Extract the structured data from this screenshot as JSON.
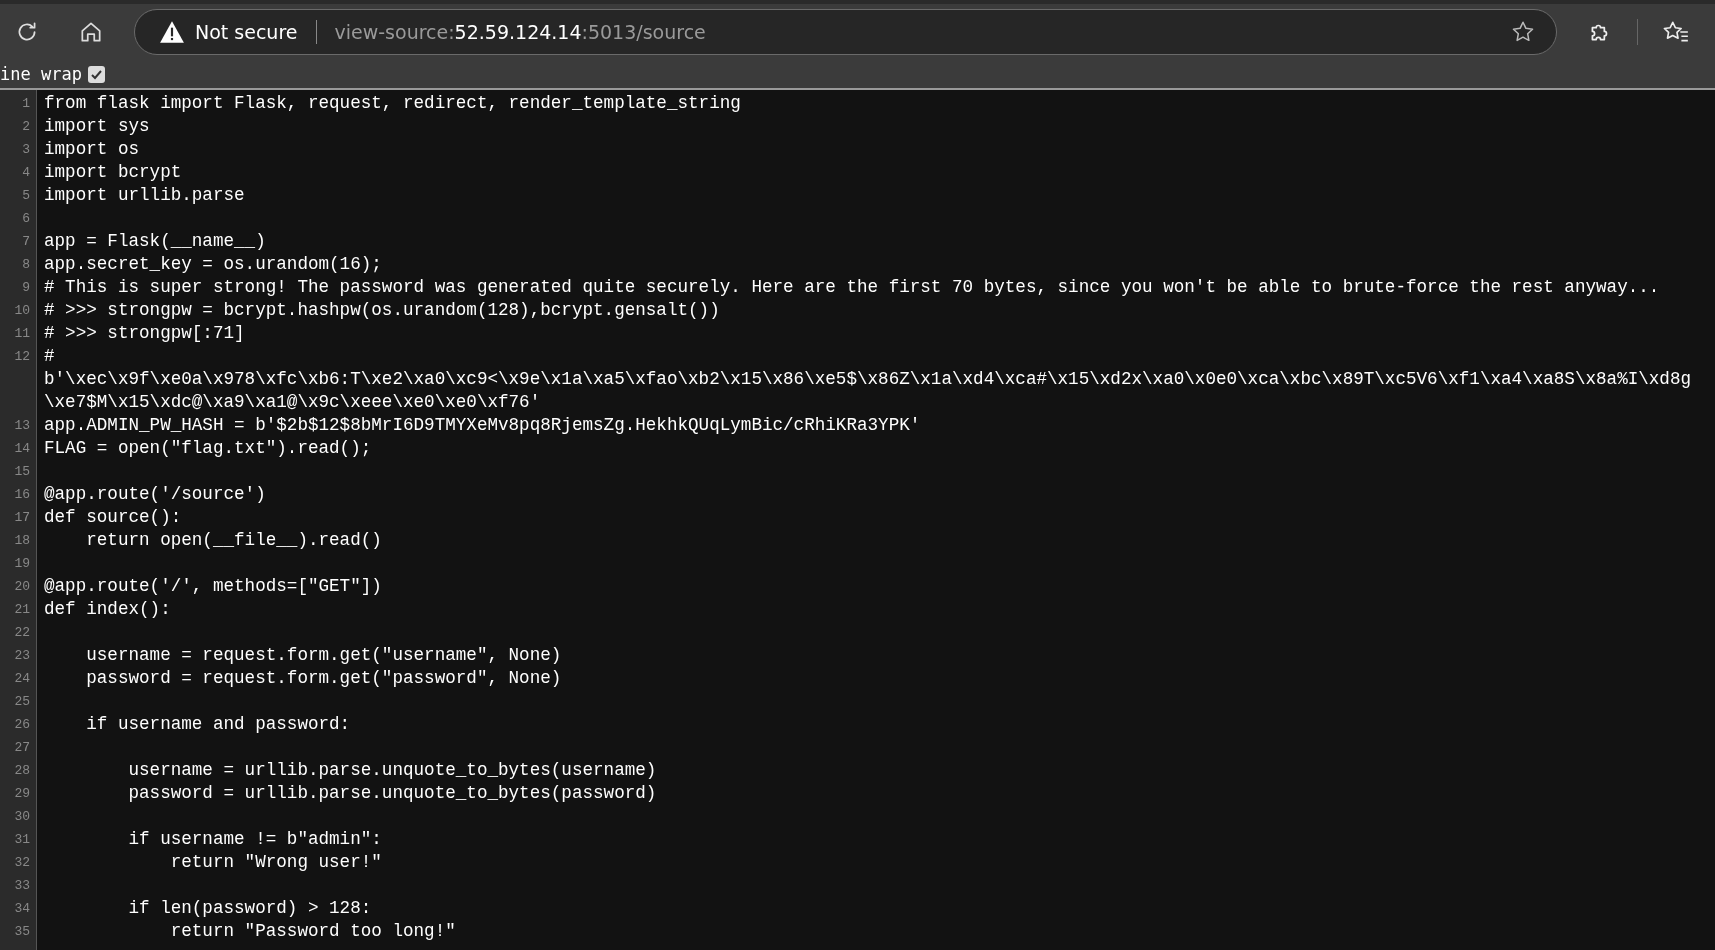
{
  "toolbar": {
    "security": "Not secure",
    "url": [
      {
        "text": "view-source:",
        "kind": "dim"
      },
      {
        "text": "52.59.124.14",
        "kind": "host"
      },
      {
        "text": ":5013/source",
        "kind": "dim"
      }
    ]
  },
  "line_wrap": {
    "label": "ine wrap",
    "checked": true
  },
  "lines": [
    {
      "number": "1",
      "text": "from flask import Flask, request, redirect, render_template_string"
    },
    {
      "number": "2",
      "text": "import sys"
    },
    {
      "number": "3",
      "text": "import os"
    },
    {
      "number": "4",
      "text": "import bcrypt"
    },
    {
      "number": "5",
      "text": "import urllib.parse"
    },
    {
      "number": "6"
    },
    {
      "number": "7",
      "text": "app = Flask(__name__)"
    },
    {
      "number": "8",
      "text": "app.secret_key = os.urandom(16);"
    },
    {
      "number": "9",
      "text": "# This is super strong! The password was generated quite securely. Here are the first 70 bytes, since you won't be able to brute-force the rest anyway..."
    },
    {
      "number": "10",
      "text": "# >>> strongpw = bcrypt.hashpw(os.urandom(128),bcrypt.gensalt())"
    },
    {
      "number": "11",
      "text": "# >>> strongpw[:71]"
    },
    {
      "number": "12",
      "rows": [
        "#",
        "b'\\xec\\x9f\\xe0a\\x978\\xfc\\xb6:T\\xe2\\xa0\\xc9<\\x9e\\x1a\\xa5\\xfao\\xb2\\x15\\x86\\xe5$\\x86Z\\x1a\\xd4\\xca#\\x15\\xd2x\\xa0\\x0e0\\xca\\xbc\\x89T\\xc5V6\\xf1\\xa4\\xa8S\\x8a%I\\xd8g",
        "\\xe7$M\\x15\\xdc@\\xa9\\xa1@\\x9c\\xeee\\xe0\\xe0\\xf76'"
      ]
    },
    {
      "number": "13",
      "text": "app.ADMIN_PW_HASH = b'$2b$12$8bMrI6D9TMYXeMv8pq8RjemsZg.HekhkQUqLymBic/cRhiKRa3YPK'"
    },
    {
      "number": "14",
      "text": "FLAG = open(\"flag.txt\").read();"
    },
    {
      "number": "15"
    },
    {
      "number": "16",
      "text": "@app.route('/source')"
    },
    {
      "number": "17",
      "text": "def source():"
    },
    {
      "number": "18",
      "text": "    return open(__file__).read()"
    },
    {
      "number": "19"
    },
    {
      "number": "20",
      "text": "@app.route('/', methods=[\"GET\"])"
    },
    {
      "number": "21",
      "text": "def index():"
    },
    {
      "number": "22"
    },
    {
      "number": "23",
      "text": "    username = request.form.get(\"username\", None)"
    },
    {
      "number": "24",
      "text": "    password = request.form.get(\"password\", None)"
    },
    {
      "number": "25"
    },
    {
      "number": "26",
      "text": "    if username and password:"
    },
    {
      "number": "27"
    },
    {
      "number": "28",
      "text": "        username = urllib.parse.unquote_to_bytes(username)"
    },
    {
      "number": "29",
      "text": "        password = urllib.parse.unquote_to_bytes(password)"
    },
    {
      "number": "30"
    },
    {
      "number": "31",
      "text": "        if username != b\"admin\":"
    },
    {
      "number": "32",
      "text": "            return \"Wrong user!\""
    },
    {
      "number": "33"
    },
    {
      "number": "34",
      "text": "        if len(password) > 128:"
    },
    {
      "number": "35",
      "text": "            return \"Password too long!\""
    }
  ]
}
